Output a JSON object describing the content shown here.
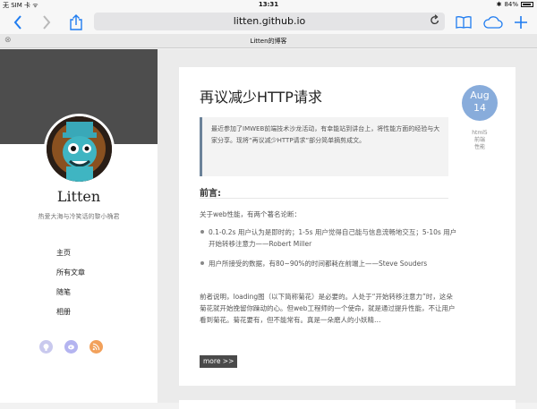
{
  "status_bar": {
    "carrier": "无 SIM 卡 ᯤ",
    "time": "13:31",
    "battery": "84%",
    "bluetooth": "✱"
  },
  "browser": {
    "url": "litten.github.io",
    "tab_title": "Litten的博客",
    "accent_color": "#1f7cf0",
    "icons": [
      "back-icon",
      "forward-icon",
      "share-icon",
      "reload-icon",
      "bookmarks-icon",
      "cloud-tabs-icon",
      "new-tab-icon",
      "close-tab-icon"
    ]
  },
  "sidebar": {
    "name": "Litten",
    "motto": "热爱大海与冷笑话的黎小桷君",
    "nav": [
      "主页",
      "所有文章",
      "随笔",
      "相册"
    ],
    "social_colors": [
      "#c9c9ee",
      "#b4b4f0",
      "#f2a15b"
    ]
  },
  "post": {
    "title": "再议减少HTTP请求",
    "date_month": "Aug",
    "date_day": "14",
    "tags": [
      "html5",
      "前端",
      "性能"
    ],
    "quote": "最近参加了IMWEB前端技术沙龙活动，有幸能站到讲台上，将性能方面的经验与大家分享。现将“再议减少HTTP请求”部分简单摘剪成文。",
    "heading": "前言:",
    "intro": "关于web性能，有两个著名论断：",
    "bullets": [
      "0.1-0.2s 用户认为是即时的；1-5s 用户觉得自己能与信息流畅地交互；5-10s 用户开始转移注意力——Robert Miller",
      "用户所接受的数据，有80~90%的时间都耗在前端上——Steve Souders"
    ],
    "body": "前者说明，loading图（以下简称菊花）是必要的。人处于“开始转移注意力”时，这朵菊花就开始挽留你躁动的心。但web工程师的一个使命，就是通过提升性能，不让用户看到菊花。菊花要有，但不能常有。真是一朵磨人的小妖精…",
    "more_label": "more >>",
    "date_color": "#88acdb"
  }
}
